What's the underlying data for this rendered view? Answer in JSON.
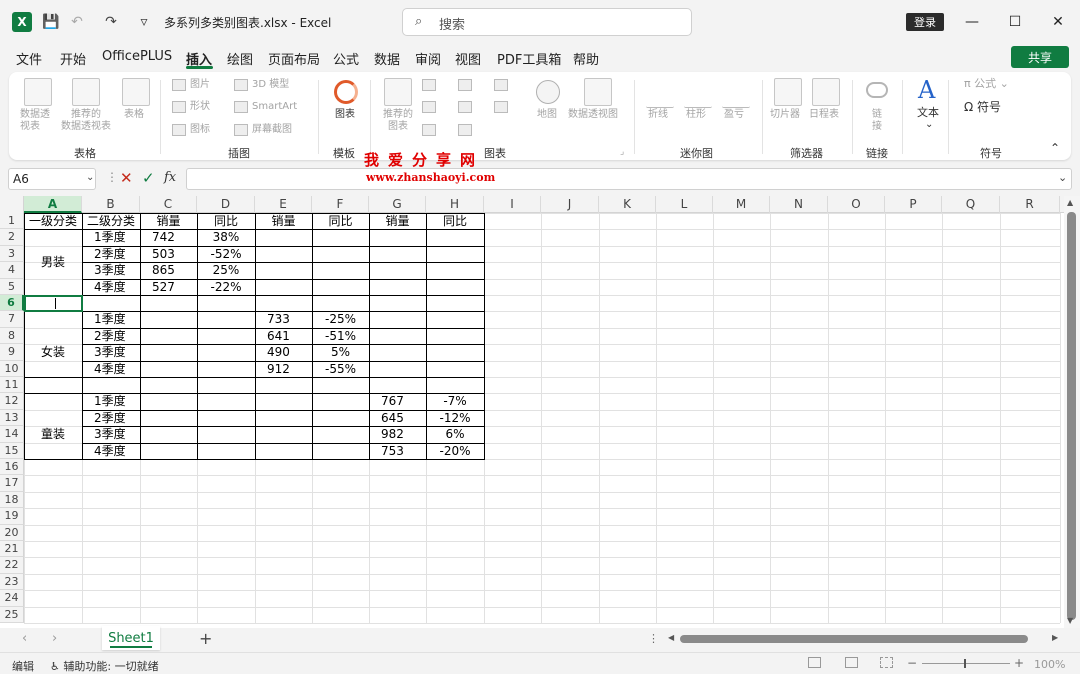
{
  "window": {
    "title": "多系列多类别图表.xlsx  -  Excel",
    "search_placeholder": "搜索",
    "login": "登录",
    "minimize": "—",
    "maximize": "☐",
    "close": "✕"
  },
  "quick": {
    "save": "💾",
    "undo": "↶",
    "redo": "↷",
    "more": "▿"
  },
  "menu": {
    "items": [
      "文件",
      "开始",
      "OfficePLUS",
      "插入",
      "绘图",
      "页面布局",
      "公式",
      "数据",
      "审阅",
      "视图",
      "PDF工具箱",
      "帮助"
    ],
    "share": "共享"
  },
  "ribbon": {
    "groups": {
      "table": "表格",
      "illustrations": "插图",
      "template": "模板",
      "charts": "图表",
      "sparklines": "迷你图",
      "filters": "筛选器",
      "links": "链接",
      "symbols": "符号"
    },
    "table": {
      "pivot1": "数据透",
      "pivot2": "视表",
      "recpivot1": "推荐的",
      "recpivot2": "数据透视表",
      "table": "表格"
    },
    "illus": {
      "pictures": "图片",
      "shapes": "形状",
      "icons": "图标",
      "model3d": "3D 模型",
      "smartart": "SmartArt",
      "screenshot": "屏幕截图"
    },
    "template": {
      "chart": "图表"
    },
    "charts": {
      "rec1": "推荐的",
      "rec2": "图表",
      "map": "地图",
      "pivotchart": "数据透视图"
    },
    "spark": {
      "line": "折线",
      "column": "柱形",
      "winloss": "盈亏"
    },
    "filters": {
      "slicer": "切片器",
      "timeline": "日程表"
    },
    "links": {
      "link1": "链",
      "link2": "接"
    },
    "text": {
      "text": "文本"
    },
    "symbols": {
      "equation": "公式",
      "symbol": "符号"
    }
  },
  "formula": {
    "namebox": "A6",
    "cancel": "✕",
    "enter": "✓",
    "fx": "fx",
    "value": ""
  },
  "watermark": {
    "cn": "我爱分享网",
    "url": "www.zhanshaoyi.com"
  },
  "sheet": {
    "columns": [
      "A",
      "B",
      "C",
      "D",
      "E",
      "F",
      "G",
      "H",
      "I",
      "J",
      "K",
      "L",
      "M",
      "N",
      "O",
      "P",
      "Q",
      "R"
    ],
    "rows": [
      "1",
      "2",
      "3",
      "4",
      "5",
      "6",
      "7",
      "8",
      "9",
      "10",
      "11",
      "12",
      "13",
      "14",
      "15",
      "16",
      "17",
      "18",
      "19",
      "20",
      "21",
      "22",
      "23",
      "24",
      "25"
    ],
    "header": [
      "一级分类",
      "二级分类",
      "销量",
      "同比",
      "销量",
      "同比",
      "销量",
      "同比"
    ],
    "categories": [
      "男装",
      "女装",
      "童装"
    ],
    "quarters": [
      "1季度",
      "2季度",
      "3季度",
      "4季度"
    ],
    "blocks": [
      {
        "sales": [
          "742",
          "503",
          "865",
          "527"
        ],
        "yoy": [
          "38%",
          "-52%",
          "25%",
          "-22%"
        ]
      },
      {
        "sales": [
          "733",
          "641",
          "490",
          "912"
        ],
        "yoy": [
          "-25%",
          "-51%",
          "5%",
          "-55%"
        ]
      },
      {
        "sales": [
          "767",
          "645",
          "982",
          "753"
        ],
        "yoy": [
          "-7%",
          "-12%",
          "6%",
          "-20%"
        ]
      }
    ]
  },
  "tabs": {
    "sheet1": "Sheet1",
    "add": "+"
  },
  "status": {
    "mode": "编辑",
    "accessibility": "辅助功能: 一切就绪",
    "zoom": "100%"
  }
}
